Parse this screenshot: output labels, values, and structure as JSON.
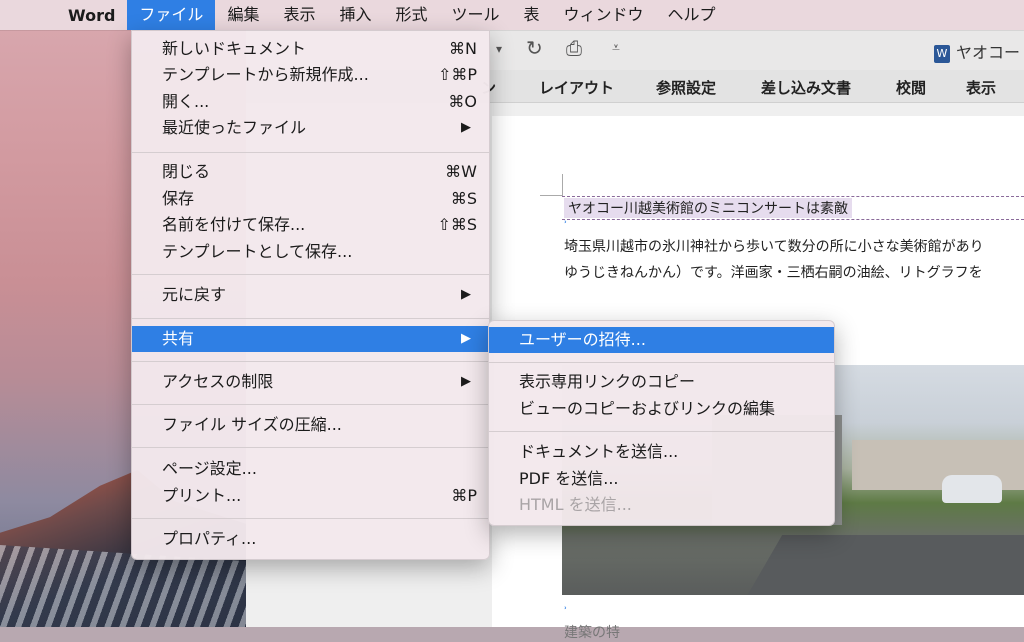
{
  "menubar": {
    "app_name": "Word",
    "items": [
      "ファイル",
      "編集",
      "表示",
      "挿入",
      "形式",
      "ツール",
      "表",
      "ウィンドウ",
      "ヘルプ"
    ]
  },
  "window": {
    "doc_title": "ヤオコー",
    "ribbon_tabs": [
      "ン",
      "レイアウト",
      "参照設定",
      "差し込み文書",
      "校閲",
      "表示"
    ]
  },
  "document": {
    "heading": "ヤオコー川越美術館のミニコンサートは素敵",
    "para1_line1": "埼玉県川越市の氷川神社から歩いて数分の所に小さな美術館があり",
    "para1_line2": "ゆうじきねんかん）です。洋画家・三栖右嗣の油絵、リトグラフを",
    "footer_text": "建築の特"
  },
  "file_menu": {
    "new_document": "新しいドキュメント",
    "new_document_sc": "⌘N",
    "from_template": "テンプレートから新規作成...",
    "from_template_sc": "⇧⌘P",
    "open": "開く...",
    "open_sc": "⌘O",
    "recent": "最近使ったファイル",
    "close": "閉じる",
    "close_sc": "⌘W",
    "save": "保存",
    "save_sc": "⌘S",
    "save_as": "名前を付けて保存...",
    "save_as_sc": "⇧⌘S",
    "save_as_template": "テンプレートとして保存...",
    "revert": "元に戻す",
    "share": "共有",
    "restrict_access": "アクセスの制限",
    "reduce_size": "ファイル サイズの圧縮...",
    "page_setup": "ページ設定...",
    "print": "プリント...",
    "print_sc": "⌘P",
    "properties": "プロパティ..."
  },
  "share_menu": {
    "invite": "ユーザーの招待...",
    "copy_view_link": "表示専用リンクのコピー",
    "copy_edit_link": "ビューのコピーおよびリンクの編集",
    "send_document": "ドキュメントを送信...",
    "send_pdf": "PDF を送信...",
    "send_html": "HTML を送信..."
  },
  "colors": {
    "highlight": "#2f7fe4"
  }
}
